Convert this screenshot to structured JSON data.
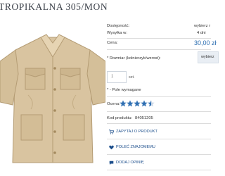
{
  "product": {
    "title": "TROPIKALNA 305/MON"
  },
  "details": {
    "availability_label": "Dostępność:",
    "availability_value": "wybierz r",
    "shipping_label": "Wysyłka w:",
    "shipping_value": "4 dni",
    "price_label": "Cena:",
    "price_value": "30,00 zł"
  },
  "size": {
    "label": "* Rozmiar (kołnierzyk/wzrost):",
    "selected": "wybierz"
  },
  "quantity": {
    "value": "1",
    "unit": "szt."
  },
  "required_note": "* - Pole wymagane",
  "rating": {
    "label": "Ocena:",
    "value": 4.5,
    "max": 5
  },
  "product_code": {
    "label": "Kod produktu:",
    "value": "84051205"
  },
  "actions": [
    {
      "label": "ZAPYTAJ O PRODUKT",
      "icon": "cart-icon"
    },
    {
      "label": "POLEĆ ZNAJOMEMU",
      "icon": "heart-icon"
    },
    {
      "label": "DODAJ OPINIĘ",
      "icon": "chat-icon"
    }
  ],
  "colors": {
    "accent": "#2a6db0",
    "link": "#1d4f8c",
    "star": "#2f6fb2",
    "shirt": "#d9c4a0"
  }
}
